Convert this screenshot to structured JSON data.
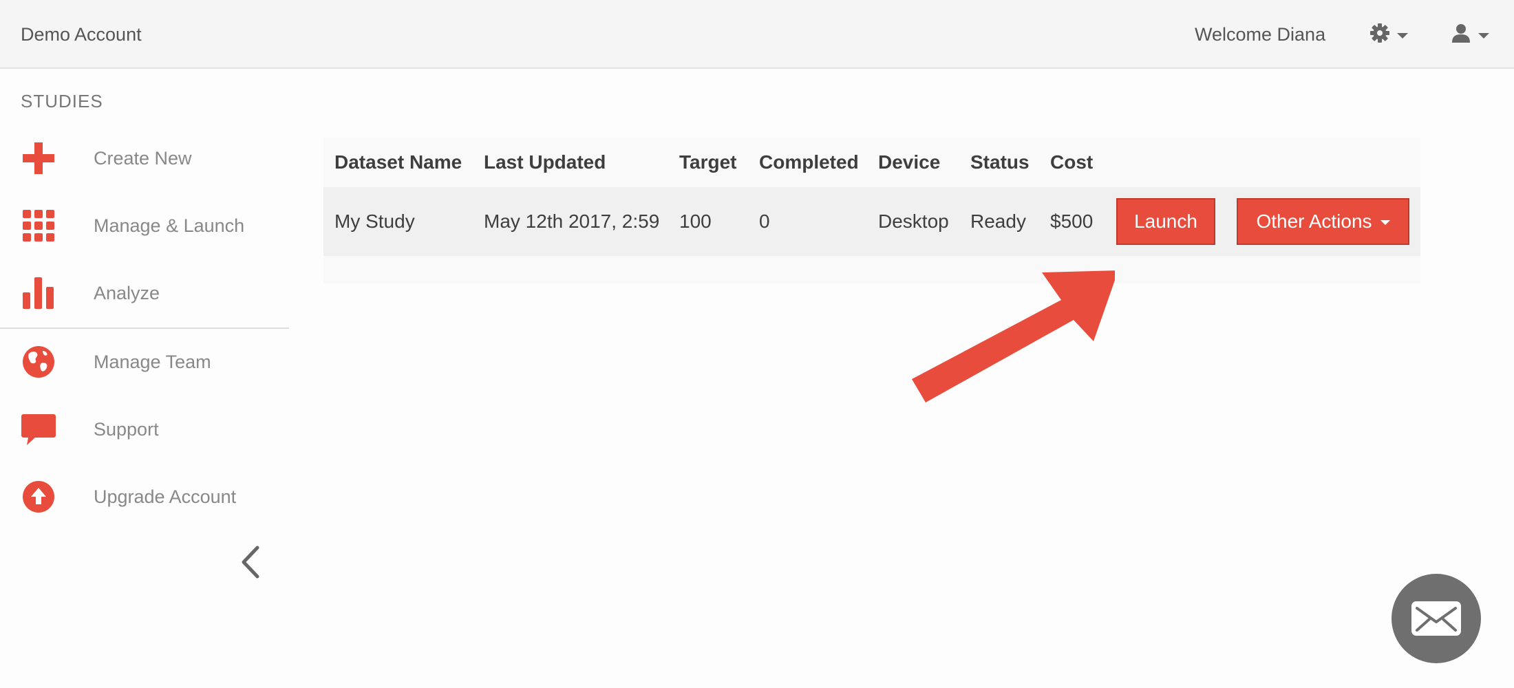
{
  "header": {
    "account_name": "Demo Account",
    "welcome_text": "Welcome Diana"
  },
  "sidebar": {
    "section_title": "STUDIES",
    "items": [
      {
        "label": "Create New",
        "icon": "plus-icon"
      },
      {
        "label": "Manage & Launch",
        "icon": "grid-icon"
      },
      {
        "label": "Analyze",
        "icon": "bar-chart-icon"
      },
      {
        "label": "Manage Team",
        "icon": "globe-icon"
      },
      {
        "label": "Support",
        "icon": "speech-bubble-icon"
      },
      {
        "label": "Upgrade Account",
        "icon": "upload-circle-icon"
      }
    ]
  },
  "table": {
    "columns": [
      "Dataset Name",
      "Last Updated",
      "Target",
      "Completed",
      "Device",
      "Status",
      "Cost"
    ],
    "rows": [
      {
        "dataset_name": "My Study",
        "last_updated": "May 12th 2017, 2:59",
        "target": "100",
        "completed": "0",
        "device": "Desktop",
        "status": "Ready",
        "cost": "$500"
      }
    ],
    "actions": {
      "launch_label": "Launch",
      "other_actions_label": "Other Actions"
    }
  },
  "colors": {
    "accent": "#e74c3c",
    "topbar": "#f5f5f5",
    "chat_button": "#6f6f6f"
  }
}
